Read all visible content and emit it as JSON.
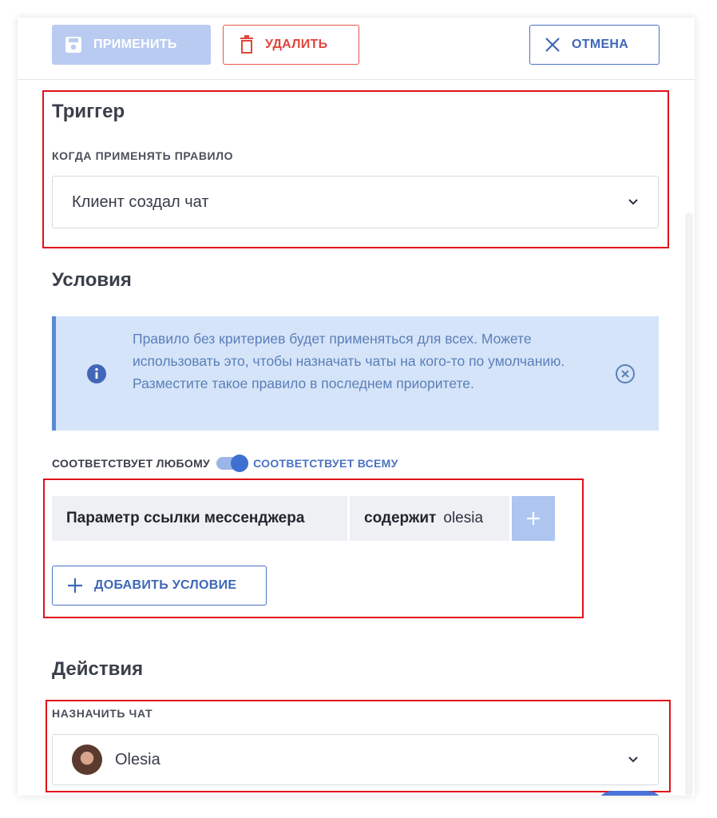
{
  "toolbar": {
    "apply_label": "ПРИМЕНИТЬ",
    "delete_label": "УДАЛИТЬ",
    "cancel_label": "ОТМЕНА"
  },
  "trigger": {
    "title": "Триггер",
    "label": "КОГДА ПРИМЕНЯТЬ ПРАВИЛО",
    "value": "Клиент создал чат"
  },
  "conditions": {
    "title": "Условия",
    "info_text": "Правило без критериев будет применяться для всех. Можете использовать это, чтобы назначать чаты на кого-то по умолчанию. Разместите такое правило в последнем приоритете.",
    "match_any_label": "СООТВЕТСТВУЕТ ЛЮБОМУ",
    "match_all_label": "СООТВЕТСТВУЕТ ВСЕМУ",
    "match_all_selected": true,
    "rule": {
      "parameter": "Параметр ссылки мессенджера",
      "operator": "содержит",
      "value": "olesia"
    },
    "add_condition_label": "ДОБАВИТЬ УСЛОВИЕ"
  },
  "actions": {
    "title": "Действия",
    "label": "НАЗНАЧИТЬ ЧАТ",
    "assignee": "Olesia"
  },
  "colors": {
    "accent": "#3e67b9",
    "danger": "#e0463b",
    "highlight": "#e0101a"
  }
}
